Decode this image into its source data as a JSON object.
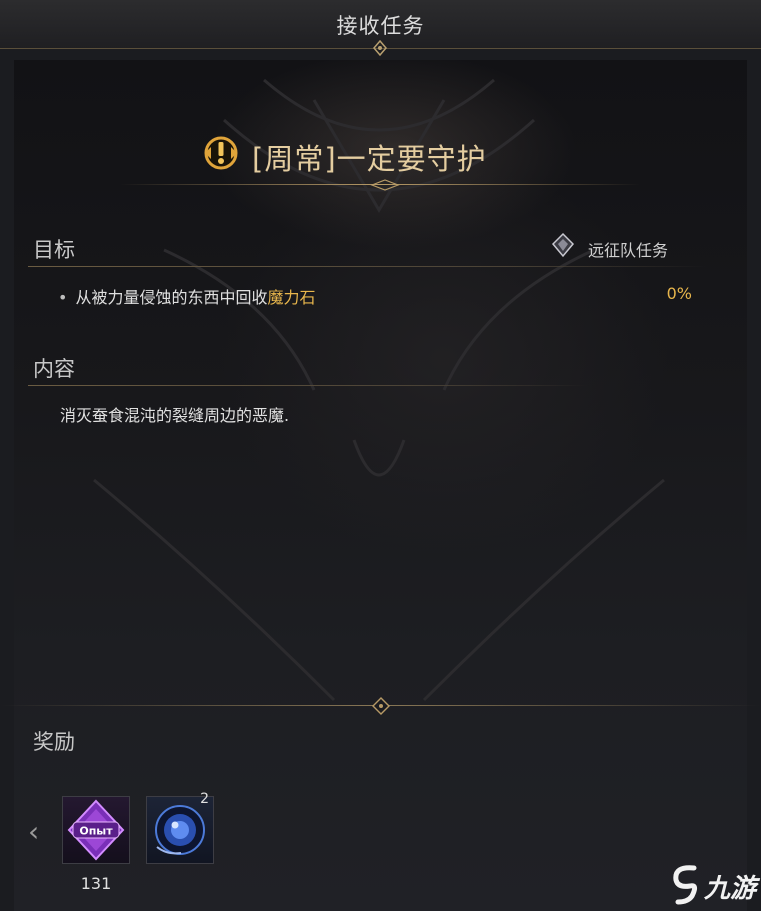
{
  "window": {
    "title": "接收任务"
  },
  "quest": {
    "title": "[周常]一定要守护",
    "icon": "quest-alert-icon"
  },
  "objective_section": {
    "label": "目标",
    "type_label": "远征队任务",
    "type_icon": "expedition-emblem-icon",
    "objectives": [
      {
        "text_prefix": "从被力量侵蚀的东西中回收",
        "text_highlight": "魔力石",
        "progress": "0%"
      }
    ]
  },
  "content_section": {
    "label": "内容",
    "text": "消灭蚕食混沌的裂缝周边的恶魔."
  },
  "reward_section": {
    "label": "奖励",
    "items": [
      {
        "name": "exp-reward",
        "label": "Опыт",
        "quantity": "131",
        "icon": "experience-crystal-icon"
      },
      {
        "name": "orb-reward",
        "badge": "2",
        "icon": "blue-orb-icon"
      }
    ]
  },
  "watermark": {
    "text": "九游"
  },
  "colors": {
    "gold_title": "#e4cda0",
    "highlight": "#e8b64c",
    "text": "#e0e0e0"
  }
}
